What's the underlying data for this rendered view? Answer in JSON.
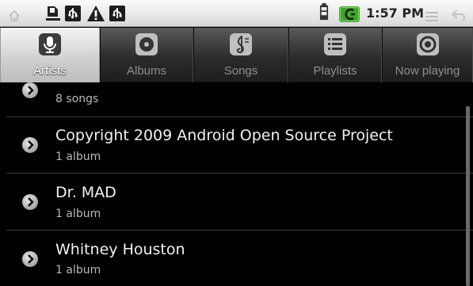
{
  "status_bar": {
    "time": "1:57 PM",
    "icons": [
      "home-icon",
      "sd-card-icon",
      "usb-icon",
      "warning-icon",
      "usb-debug-icon",
      "battery-icon",
      "signal-icon",
      "menu-icon",
      "back-icon"
    ]
  },
  "tabs": [
    {
      "label": "Artists",
      "icon": "microphone-icon",
      "selected": true
    },
    {
      "label": "Albums",
      "icon": "album-icon",
      "selected": false
    },
    {
      "label": "Songs",
      "icon": "music-note-icon",
      "selected": false
    },
    {
      "label": "Playlists",
      "icon": "playlist-icon",
      "selected": false
    },
    {
      "label": "Now playing",
      "icon": "now-playing-icon",
      "selected": false
    }
  ],
  "list": {
    "partial_item": {
      "subtitle": "8 songs"
    },
    "items": [
      {
        "title": "Copyright 2009 Android Open Source Project",
        "subtitle": "1 album"
      },
      {
        "title": "Dr. MAD",
        "subtitle": "1 album"
      },
      {
        "title": "Whitney Houston",
        "subtitle": "1 album"
      }
    ]
  },
  "colors": {
    "status_bar": "#e6e6e6",
    "tab_bar": "#2c2c2c",
    "tab_selected": "#dcdcdc",
    "list_background": "#000000",
    "battery_green": "#3fa62b"
  }
}
